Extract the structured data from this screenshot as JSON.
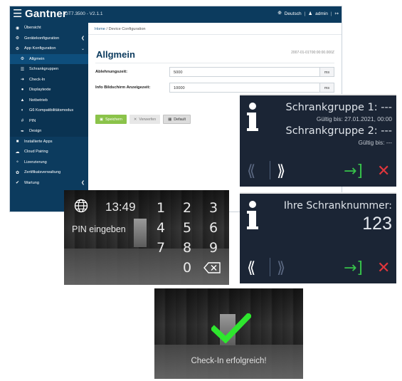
{
  "admin": {
    "brand": "Gantner",
    "version": "GT7.3500 - V2.1.1",
    "language": "Deutsch",
    "user": "admin",
    "breadcrumb_home": "Home",
    "breadcrumb_sep": "/",
    "breadcrumb_current": "Device Configuration",
    "sidebar": [
      {
        "label": "Übersicht",
        "icon": "dashboard-icon"
      },
      {
        "label": "Gerätekonfiguration",
        "icon": "gear-icon"
      },
      {
        "label": "App Konfiguration",
        "icon": "gears-icon"
      },
      {
        "label": "Allgmein",
        "icon": "gear-icon"
      },
      {
        "label": "Schrankgruppen",
        "icon": "list-icon"
      },
      {
        "label": "Check-In",
        "icon": "signin-icon"
      },
      {
        "label": "Displaytexte",
        "icon": "comment-icon"
      },
      {
        "label": "Notbetrieb",
        "icon": "warning-icon"
      },
      {
        "label": "G6 Kompatibilitätsmodus",
        "icon": "compat-icon"
      },
      {
        "label": "PIN",
        "icon": "hash-icon"
      },
      {
        "label": "Design",
        "icon": "brush-icon"
      },
      {
        "label": "Installierte Apps",
        "icon": "apps-icon"
      },
      {
        "label": "Cloud Pairing",
        "icon": "cloud-icon"
      },
      {
        "label": "Lizenzierung",
        "icon": "key-icon"
      },
      {
        "label": "Zertifikatsverwaltung",
        "icon": "certificate-icon"
      },
      {
        "label": "Wartung",
        "icon": "wrench-icon"
      }
    ],
    "page_title": "Allgmein",
    "timestamp": "2007-01-01T00:00:00.000Z",
    "fields": [
      {
        "label": "Ablehnungszeit:",
        "value": "5000",
        "unit": "ms"
      },
      {
        "label": "Info Bildschirm Anzeigezeit:",
        "value": "10000",
        "unit": "ms"
      }
    ],
    "buttons": {
      "save": "Speichern",
      "discard": "Verwerfen",
      "default": "Default"
    }
  },
  "info_screen_1": {
    "group1": "Schrankgruppe 1: ---",
    "valid1": "Gültig bis: 27.01.2021, 00:00",
    "group2": "Schrankgruppe 2: ---",
    "valid2": "Gültig bis: ---"
  },
  "pin_screen": {
    "time": "13:49",
    "prompt": "PIN eingeben",
    "keys": [
      "1",
      "2",
      "3",
      "4",
      "5",
      "6",
      "7",
      "8",
      "9",
      "0"
    ]
  },
  "info_screen_2": {
    "label": "Ihre Schranknummer:",
    "number": "123"
  },
  "checkin_screen": {
    "message": "Check-In erfolgreich!"
  },
  "colors": {
    "navy": "#0c3b5e",
    "accept_green": "#37c24a",
    "cancel_red": "#e0363c",
    "save_green": "#8bc34a",
    "check_green": "#2ee62e"
  }
}
